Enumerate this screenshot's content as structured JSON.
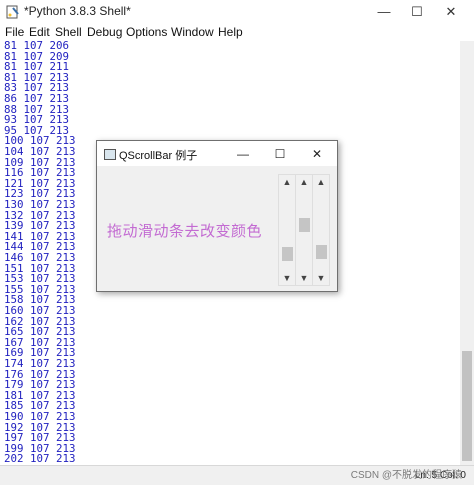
{
  "window": {
    "title": "*Python 3.8.3 Shell*",
    "controls": {
      "minimize": "—",
      "maximize": "☐",
      "close": "✕"
    }
  },
  "menu": [
    "File",
    "Edit",
    "Shell",
    "Debug",
    "Options",
    "Window",
    "Help"
  ],
  "output_lines": [
    "81 107 206",
    "81 107 209",
    "81 107 211",
    "81 107 213",
    "83 107 213",
    "86 107 213",
    "88 107 213",
    "93 107 213",
    "95 107 213",
    "100 107 213",
    "104 107 213",
    "109 107 213",
    "116 107 213",
    "121 107 213",
    "123 107 213",
    "130 107 213",
    "132 107 213",
    "139 107 213",
    "141 107 213",
    "144 107 213",
    "146 107 213",
    "151 107 213",
    "153 107 213",
    "155 107 213",
    "158 107 213",
    "160 107 213",
    "162 107 213",
    "165 107 213",
    "167 107 213",
    "169 107 213",
    "174 107 213",
    "176 107 213",
    "179 107 213",
    "181 107 213",
    "185 107 213",
    "190 107 213",
    "192 107 213",
    "197 107 213",
    "199 107 213",
    "202 107 213"
  ],
  "status": "Ln: 5  Col: 0",
  "watermark": "CSDN @不脱发的程序猿",
  "dialog": {
    "title": "QScrollBar 例子",
    "controls": {
      "minimize": "—",
      "maximize": "☐",
      "close": "✕"
    },
    "label": "拖动滑动条去改变颜色",
    "label_color": "#c36bd2",
    "scrollbars": [
      {
        "name": "red",
        "level": 0.85
      },
      {
        "name": "green",
        "level": 0.42
      },
      {
        "name": "blue",
        "level": 0.83
      }
    ],
    "arrow_up": "▲",
    "arrow_down": "▼"
  }
}
